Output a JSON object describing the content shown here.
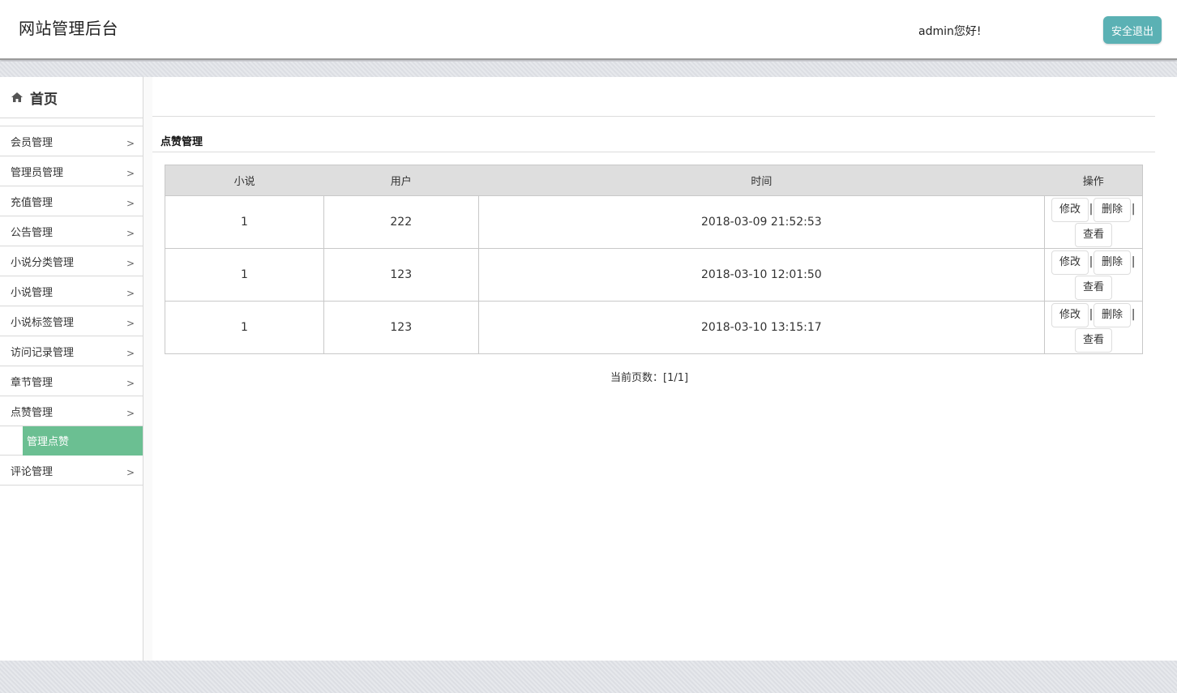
{
  "header": {
    "site_title": "网站管理后台",
    "greeting": "admin您好!",
    "logout_label": "安全退出"
  },
  "sidebar": {
    "home_label": "首页",
    "items": [
      {
        "label": "会员管理",
        "arrow": ">"
      },
      {
        "label": "管理员管理",
        "arrow": ">"
      },
      {
        "label": "充值管理",
        "arrow": ">"
      },
      {
        "label": "公告管理",
        "arrow": ">"
      },
      {
        "label": "小说分类管理",
        "arrow": ">"
      },
      {
        "label": "小说管理",
        "arrow": ">"
      },
      {
        "label": "小说标签管理",
        "arrow": ">"
      },
      {
        "label": "访问记录管理",
        "arrow": ">"
      },
      {
        "label": "章节管理",
        "arrow": ">"
      },
      {
        "label": "点赞管理",
        "arrow": ">"
      },
      {
        "label": "评论管理",
        "arrow": ">"
      }
    ],
    "active_sub": "管理点赞"
  },
  "main": {
    "section_title": "点赞管理",
    "table": {
      "headers": [
        "小说",
        "用户",
        "时间",
        "操作"
      ],
      "rows": [
        {
          "novel": "1",
          "user": "222",
          "time": "2018-03-09 21:52:53"
        },
        {
          "novel": "1",
          "user": "123",
          "time": "2018-03-10 12:01:50"
        },
        {
          "novel": "1",
          "user": "123",
          "time": "2018-03-10 13:15:17"
        }
      ],
      "actions": {
        "edit": "修改",
        "delete": "删除",
        "view": "查看",
        "separator": "|"
      }
    },
    "pager": "当前页数：[1/1]"
  },
  "colors": {
    "logout_bg": "#5bb1b4",
    "active_submenu_bg": "#6bbf92",
    "table_header_bg": "#dedede"
  }
}
